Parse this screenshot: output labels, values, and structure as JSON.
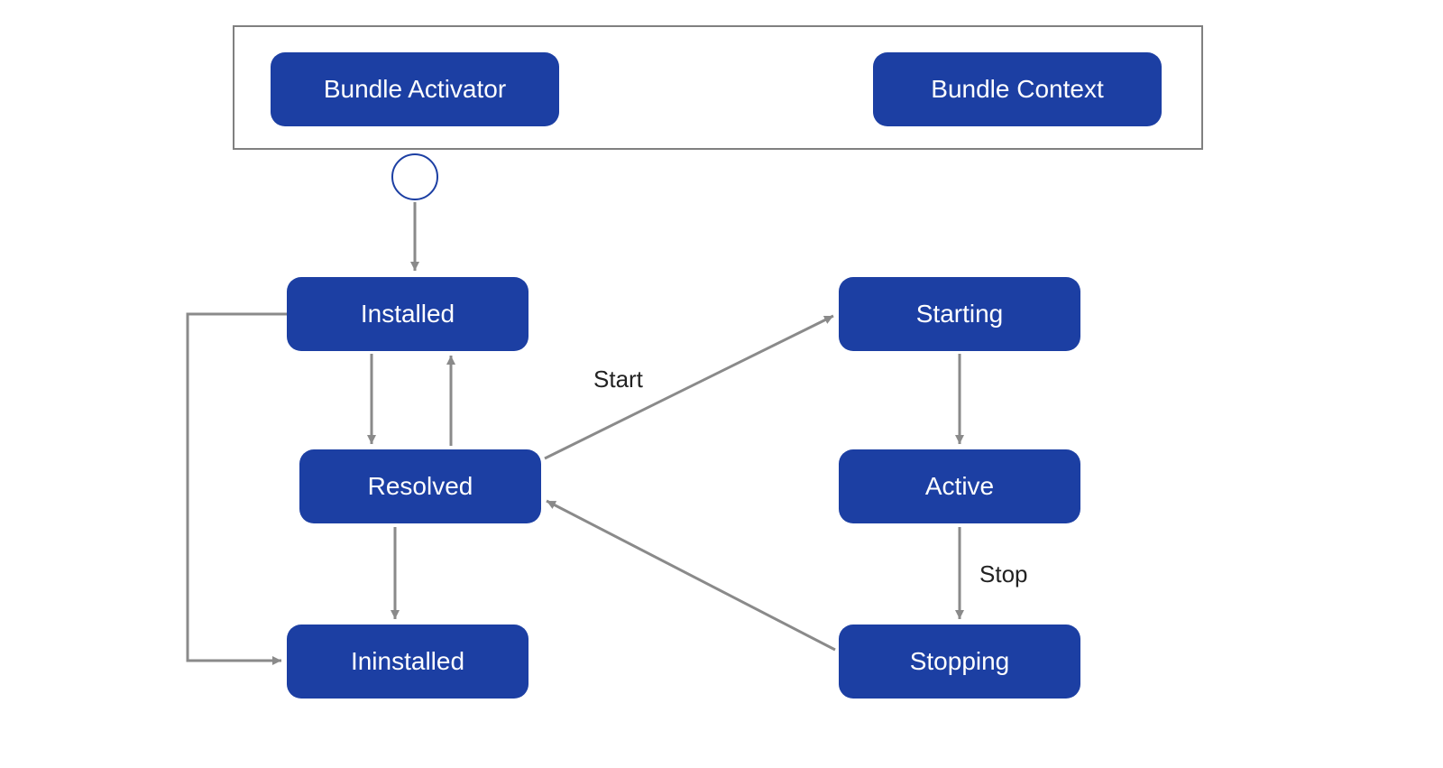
{
  "colors": {
    "node_fill": "#1c3fa3",
    "node_text": "#ffffff",
    "frame_border": "#808080",
    "arrow": "#8a8a8a",
    "circle_border": "#1c3fa3"
  },
  "nodes": {
    "bundle_activator": {
      "label": "Bundle Activator"
    },
    "bundle_context": {
      "label": "Bundle Context"
    },
    "installed": {
      "label": "Installed"
    },
    "resolved": {
      "label": "Resolved"
    },
    "uninstalled": {
      "label": "Ininstalled"
    },
    "starting": {
      "label": "Starting"
    },
    "active": {
      "label": "Active"
    },
    "stopping": {
      "label": "Stopping"
    }
  },
  "edges": {
    "start": {
      "label": "Start"
    },
    "stop": {
      "label": "Stop"
    }
  },
  "transitions": [
    {
      "from": "initial_circle",
      "to": "installed"
    },
    {
      "from": "installed",
      "to": "resolved"
    },
    {
      "from": "resolved",
      "to": "installed"
    },
    {
      "from": "resolved",
      "to": "uninstalled"
    },
    {
      "from": "installed",
      "to": "uninstalled"
    },
    {
      "from": "resolved",
      "to": "starting",
      "label_key": "start"
    },
    {
      "from": "starting",
      "to": "active"
    },
    {
      "from": "active",
      "to": "stopping",
      "label_key": "stop"
    },
    {
      "from": "stopping",
      "to": "resolved"
    }
  ]
}
